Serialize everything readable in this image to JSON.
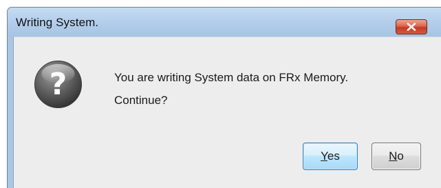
{
  "window": {
    "title": "Writing System.",
    "close_icon": "close-icon"
  },
  "dialog": {
    "icon": "question-icon",
    "icon_glyph": "?",
    "message_line1": "You are writing System data on FRx Memory.",
    "message_line2": "Continue?"
  },
  "buttons": {
    "yes_label": "Yes",
    "no_label": "No"
  },
  "colors": {
    "titlebar": "#b2cdea",
    "client_bg": "#ededed",
    "close_button": "#c43c25",
    "default_button_border": "#3c7fb1"
  }
}
